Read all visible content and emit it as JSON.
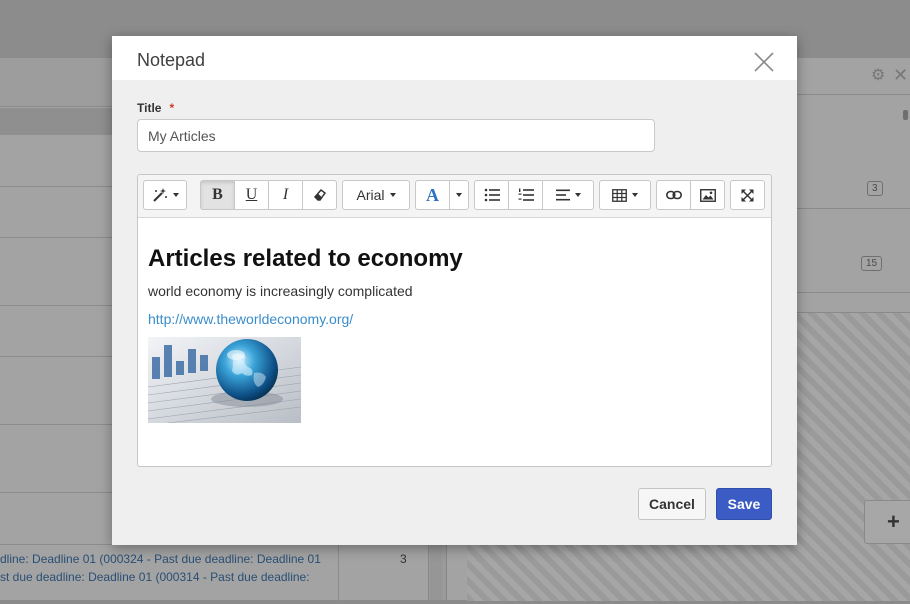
{
  "modal": {
    "title": "Notepad",
    "title_field_label": "Title",
    "required_marker": "*",
    "title_value": "My Articles",
    "cancel_label": "Cancel",
    "save_label": "Save"
  },
  "toolbar": {
    "font_name": "Arial",
    "bold_label": "B",
    "underline_label": "U",
    "italic_label": "I",
    "font_color_label": "A",
    "buttons": [
      "magic-wand",
      "bold",
      "underline",
      "italic",
      "eraser",
      "font-family",
      "font-color",
      "unordered-list",
      "ordered-list",
      "align",
      "table",
      "link",
      "picture",
      "fullscreen"
    ]
  },
  "editor_content": {
    "heading": "Articles related to economy",
    "paragraph": "world economy is increasingly complicated",
    "link": "http://www.theworldeconomy.org/"
  },
  "background": {
    "row1": "dline: Deadline 01 (000324 - Past due deadline: Deadline 01",
    "row2": "st due deadline: Deadline 01 (000314 - Past due deadline:",
    "row_count": "3",
    "badge1": "3",
    "badge2": "15"
  },
  "colors": {
    "accent": "#3b5cc4",
    "link": "#3a8dcc",
    "required": "#d9352a"
  }
}
